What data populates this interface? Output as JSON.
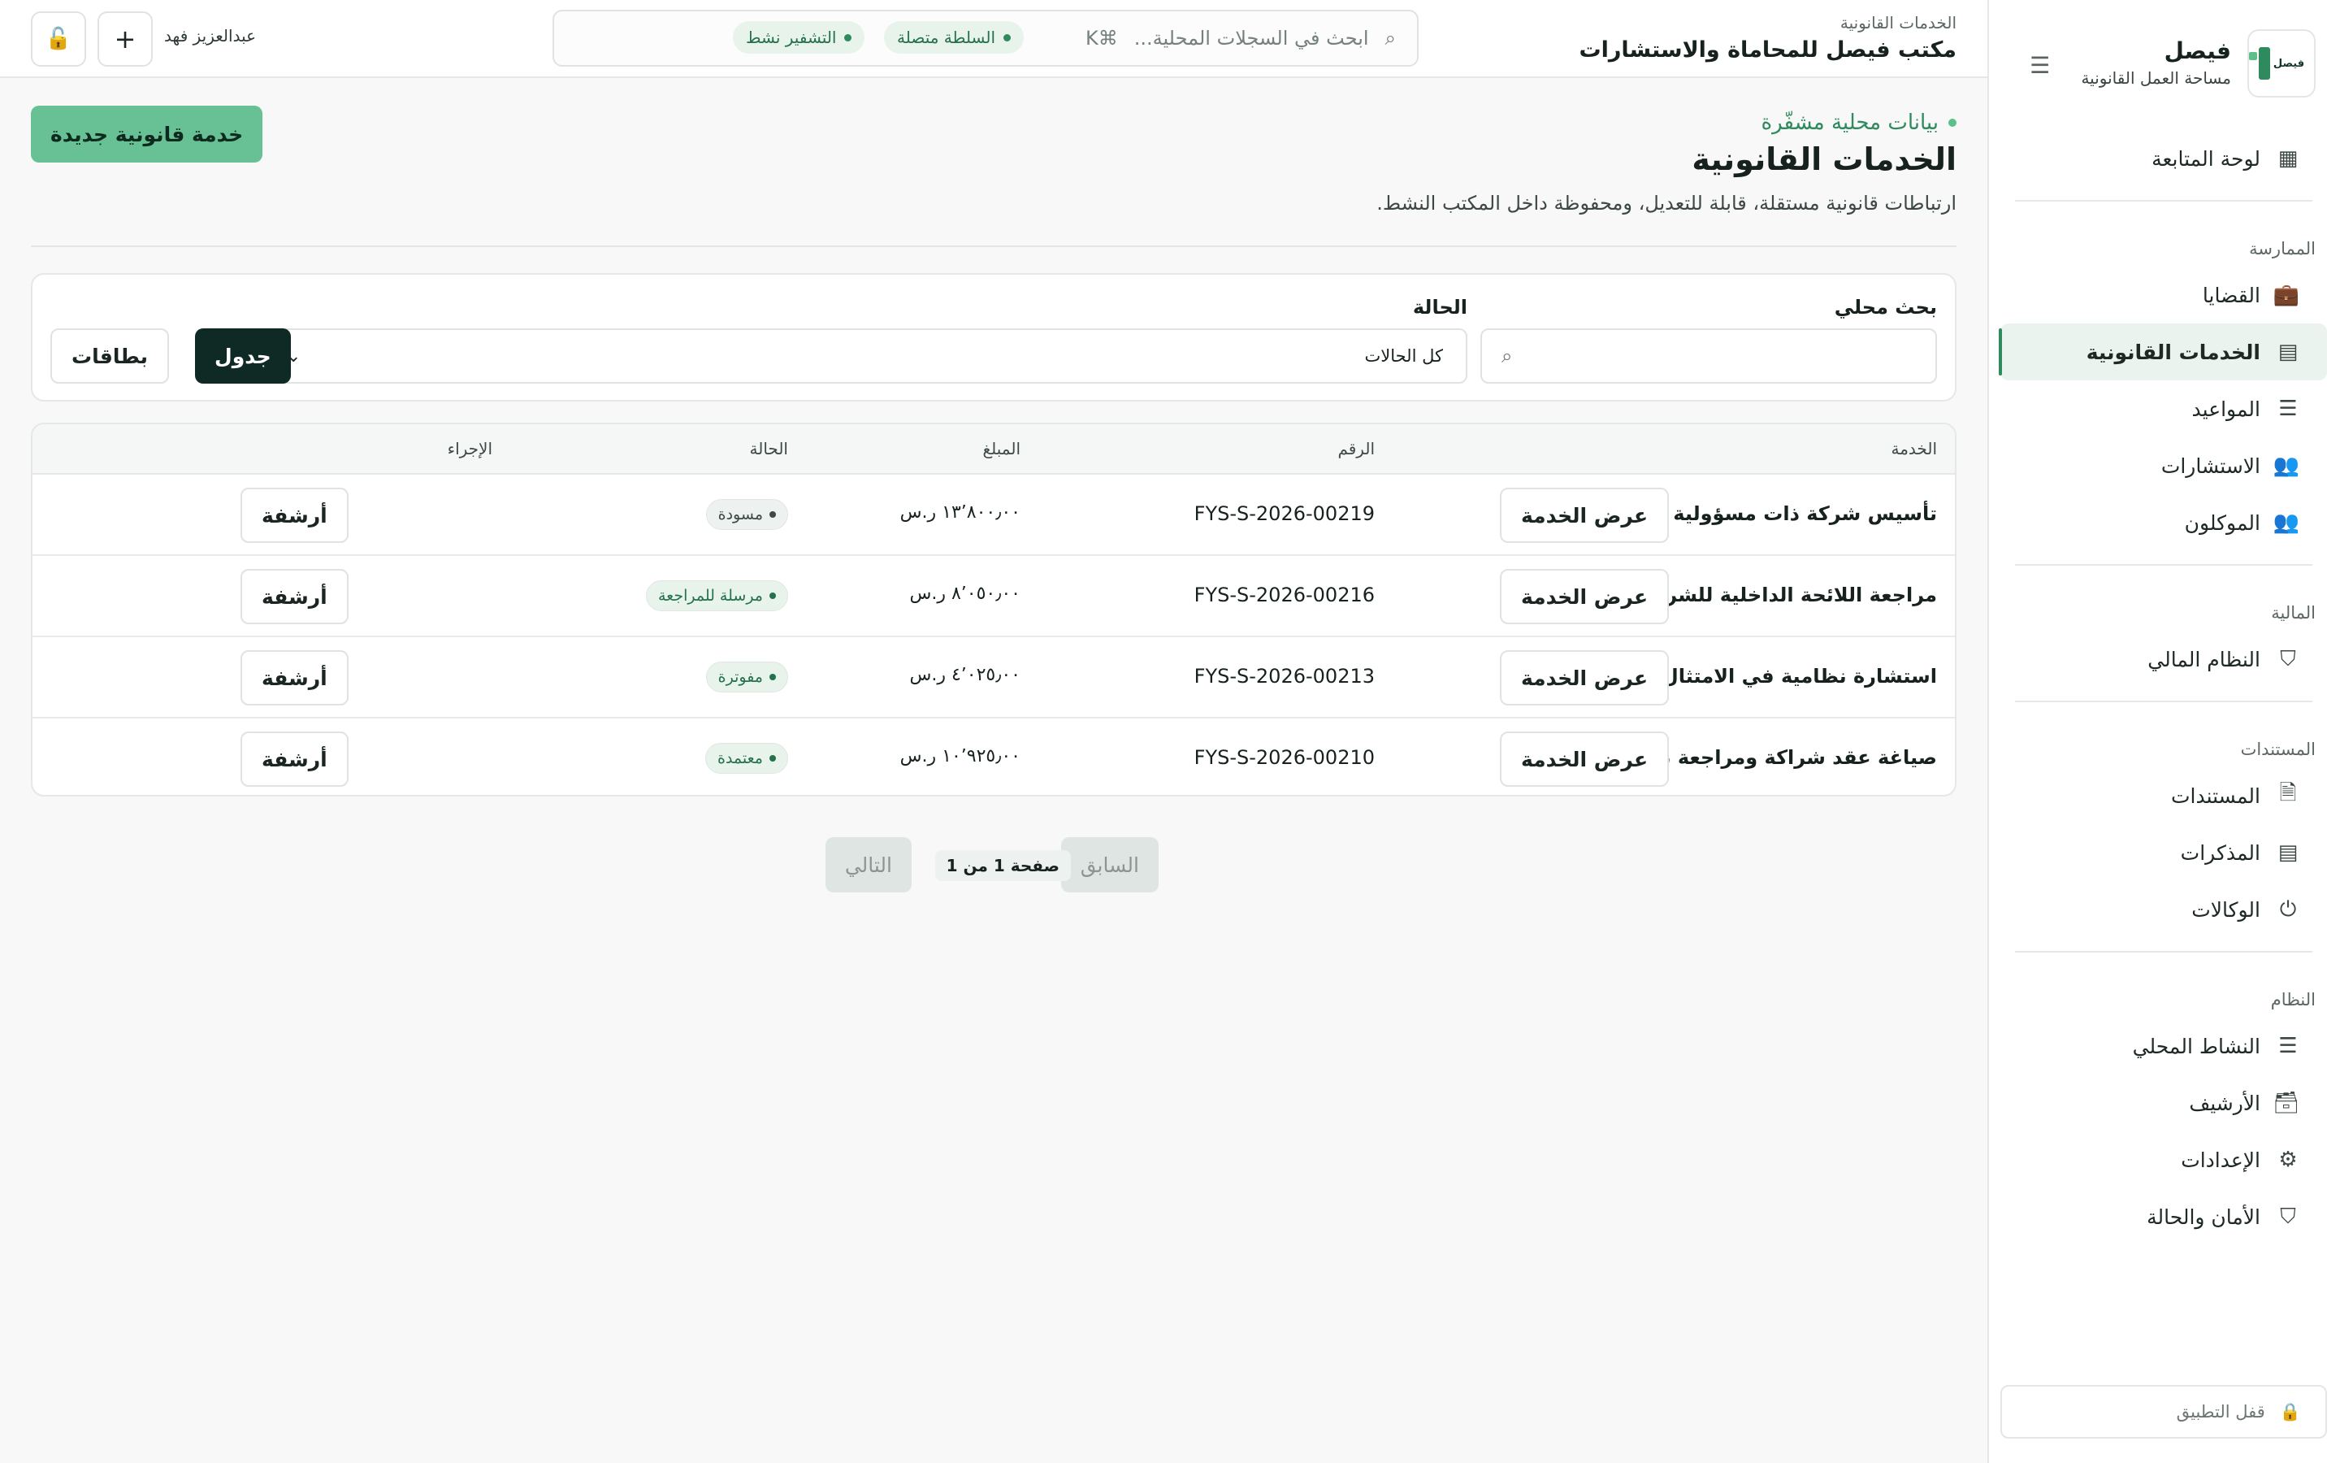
{
  "brand": {
    "logo_text": "فيصل",
    "title": "فيصل",
    "subtitle": "مساحة العمل القانونية"
  },
  "nav": {
    "dashboard": "لوحة المتابعة",
    "sec_practice": "الممارسة",
    "cases": "القضايا",
    "services": "الخدمات القانونية",
    "appointments": "المواعيد",
    "consultations": "الاستشارات",
    "clients": "الموكلون",
    "sec_finance": "المالية",
    "finance": "النظام المالي",
    "sec_docs": "المستندات",
    "documents": "المستندات",
    "memos": "المذكرات",
    "poa": "الوكالات",
    "sec_system": "النظام",
    "activity": "النشاط المحلي",
    "archive": "الأرشيف",
    "settings": "الإعدادات",
    "security": "الأمان والحالة",
    "lock_app": "قفل التطبيق"
  },
  "topbar": {
    "breadcrumb": "الخدمات القانونية",
    "office": "مكتب فيصل للمحاماة والاستشارات",
    "search_placeholder": "ابحث في السجلات المحلية...",
    "search_shortcut": "⌘K",
    "status_authority": "السلطة متصلة",
    "status_encryption": "التشفير نشط",
    "user": "عبدالعزيز فهد"
  },
  "page": {
    "hint": "بيانات محلية مشفّرة",
    "title": "الخدمات القانونية",
    "description": "ارتباطات قانونية مستقلة، قابلة للتعديل، ومحفوظة داخل المكتب النشط.",
    "new_button": "خدمة قانونية جديدة"
  },
  "filters": {
    "search_label": "بحث محلي",
    "status_label": "الحالة",
    "status_value": "كل الحالات",
    "view_table": "جدول",
    "view_cards": "بطاقات"
  },
  "table": {
    "headers": {
      "service": "الخدمة",
      "number": "الرقم",
      "amount": "المبلغ",
      "status": "الحالة",
      "action": "الإجراء"
    },
    "rows": [
      {
        "service": "تأسيس شركة ذات مسؤولية محدودة",
        "number": "FYS-S-2026-00219",
        "amount": "١٣٬٨٠٠٫٠٠ ر.س",
        "status": "مسودة",
        "view": "عرض الخدمة",
        "archive": "أرشفة"
      },
      {
        "service": "مراجعة اللائحة الداخلية للشركة",
        "number": "FYS-S-2026-00216",
        "amount": "٨٬٠٥٠٫٠٠ ر.س",
        "status": "مرسلة للمراجعة",
        "view": "عرض الخدمة",
        "archive": "أرشفة"
      },
      {
        "service": "استشارة نظامية في الامتثال لنظام العمل",
        "number": "FYS-S-2026-00213",
        "amount": "٤٬٠٢٥٫٠٠ ر.س",
        "status": "مفوترة",
        "view": "عرض الخدمة",
        "archive": "أرشفة"
      },
      {
        "service": "صياغة عقد شراكة ومراجعة بنوده",
        "number": "FYS-S-2026-00210",
        "amount": "١٠٬٩٢٥٫٠٠ ر.س",
        "status": "معتمدة",
        "view": "عرض الخدمة",
        "archive": "أرشفة"
      }
    ]
  },
  "pager": {
    "prev": "السابق",
    "info": "صفحة 1 من 1",
    "next": "التالي"
  },
  "colors": {
    "accent": "#2f8a5e",
    "primary_button": "#67c194",
    "dark_button": "#0f2a25",
    "sidebar_active_bg": "#eaf3ee"
  }
}
